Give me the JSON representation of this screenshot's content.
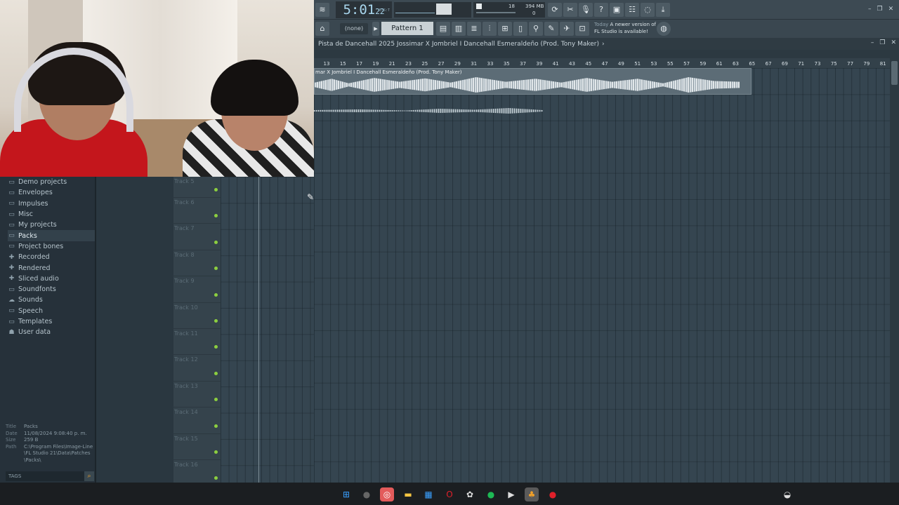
{
  "transport": {
    "time_main": "5:01",
    "time_sub": "22",
    "time_label": "B:S:T",
    "cpu_value": "18",
    "memory": "394 MB",
    "poly": "0"
  },
  "toolbar": {
    "snap_value": "(none)",
    "pattern": "Pattern 1",
    "notice_today": "Today",
    "notice_text_1": "A newer version of",
    "notice_text_2": "FL Studio is available!"
  },
  "playlist": {
    "title": "Pista de Dancehall 2025 Jossimar X Jombriel I Dancehall Esmeraldeño (Prod. Tony Maker)",
    "title_arrow": "›",
    "clip_label": "mar X Jombriel I Dancehall Esmeraldeño (Prod. Tony Maker)",
    "ruler_ticks": [
      "13",
      "15",
      "17",
      "19",
      "21",
      "23",
      "25",
      "27",
      "29",
      "31",
      "33",
      "35",
      "37",
      "39",
      "41",
      "43",
      "45",
      "47",
      "49",
      "51",
      "53",
      "55",
      "57",
      "59",
      "61",
      "63",
      "65",
      "67",
      "69",
      "71",
      "73",
      "75",
      "77",
      "79",
      "81"
    ],
    "tracks": [
      {
        "name": "Track 5"
      },
      {
        "name": "Track 6"
      },
      {
        "name": "Track 7"
      },
      {
        "name": "Track 8"
      },
      {
        "name": "Track 9"
      },
      {
        "name": "Track 10"
      },
      {
        "name": "Track 11"
      },
      {
        "name": "Track 12"
      },
      {
        "name": "Track 13"
      },
      {
        "name": "Track 14"
      },
      {
        "name": "Track 15"
      },
      {
        "name": "Track 16"
      }
    ]
  },
  "browser": {
    "items": [
      {
        "label": "Demo projects",
        "icon": "folder-icon"
      },
      {
        "label": "Envelopes",
        "icon": "folder-icon"
      },
      {
        "label": "Impulses",
        "icon": "folder-icon"
      },
      {
        "label": "Misc",
        "icon": "folder-icon"
      },
      {
        "label": "My projects",
        "icon": "folder-icon"
      },
      {
        "label": "Packs",
        "icon": "folder-open-icon",
        "selected": true
      },
      {
        "label": "Project bones",
        "icon": "folder-icon"
      },
      {
        "label": "Recorded",
        "icon": "plus-icon"
      },
      {
        "label": "Rendered",
        "icon": "plus-icon"
      },
      {
        "label": "Sliced audio",
        "icon": "plus-icon"
      },
      {
        "label": "Soundfonts",
        "icon": "folder-icon"
      },
      {
        "label": "Sounds",
        "icon": "cloud-icon"
      },
      {
        "label": "Speech",
        "icon": "folder-icon"
      },
      {
        "label": "Templates",
        "icon": "folder-icon"
      },
      {
        "label": "User data",
        "icon": "user-icon"
      }
    ],
    "info": {
      "title_key": "Title",
      "title_val": "Packs",
      "date_key": "Date",
      "date_val": "11/08/2024 9:08:40 p. m.",
      "size_key": "Size",
      "size_val": "259 B",
      "path_key": "Path",
      "path_val": "C:\\Program Files\\Image-Line\\FL Studio 21\\Data\\Patches\\Packs\\"
    },
    "tags_label": "TAGS"
  },
  "colors": {
    "accent": "#f0a02a",
    "track_led": "#8ccf3f",
    "playlist_bg": "#354550"
  }
}
